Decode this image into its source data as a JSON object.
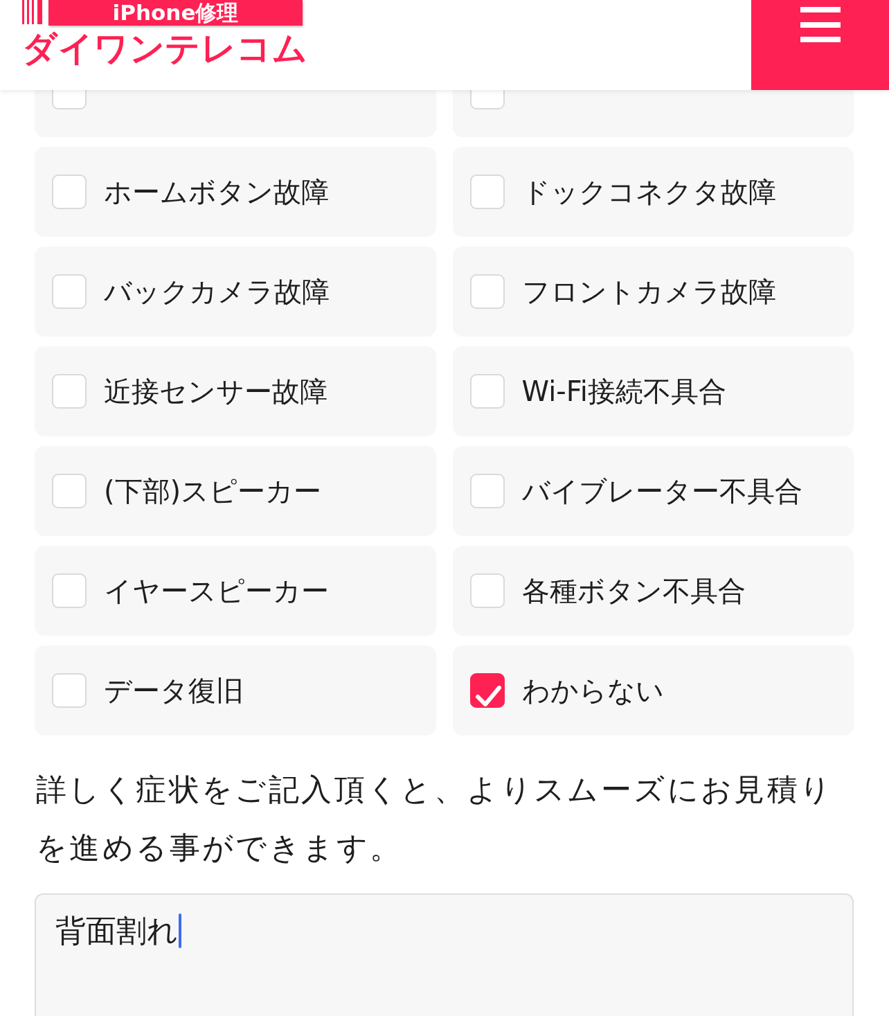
{
  "header": {
    "logo_tagline": "iPhone修理",
    "logo_name": "ダイワンテレコム"
  },
  "options": [
    {
      "checked": false
    },
    {
      "checked": false
    },
    {
      "label": "ホームボタン故障",
      "checked": false
    },
    {
      "label": "ドックコネクタ故障",
      "checked": false
    },
    {
      "label": "バックカメラ故障",
      "checked": false
    },
    {
      "label": "フロントカメラ故障",
      "checked": false
    },
    {
      "label": "近接センサー故障",
      "checked": false
    },
    {
      "label": "Wi-Fi接続不具合",
      "checked": false
    },
    {
      "label": "(下部)スピーカー",
      "checked": false
    },
    {
      "label": "バイブレーター不具合",
      "checked": false
    },
    {
      "label": "イヤースピーカー",
      "checked": false
    },
    {
      "label": "各種ボタン不具合",
      "checked": false
    },
    {
      "label": "データ復旧",
      "checked": false
    },
    {
      "label": "わからない",
      "checked": true
    }
  ],
  "note": "詳しく症状をご記入頂くと、よりスムーズにお見積りを進める事ができます。",
  "details_field": {
    "value": "背面割れ",
    "focused": true
  }
}
